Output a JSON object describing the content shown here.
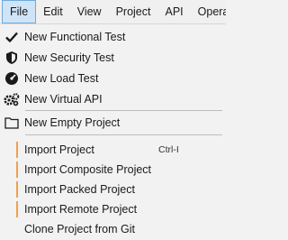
{
  "menubar": {
    "items": [
      "File",
      "Edit",
      "View",
      "Project",
      "API",
      "Operatio"
    ]
  },
  "menu": {
    "new_functional_test": "New Functional Test",
    "new_security_test": "New Security Test",
    "new_load_test": "New Load Test",
    "new_virtual_api": "New Virtual API",
    "new_empty_project": "New Empty Project",
    "import_project": "Import Project",
    "import_project_shortcut": "Ctrl-I",
    "import_composite_project": "Import Composite Project",
    "import_packed_project": "Import Packed Project",
    "import_remote_project": "Import Remote Project",
    "clone_project_from_git": "Clone Project from Git"
  },
  "colors": {
    "accent_bar": "#f0a04b",
    "active_menu_bg": "#cfe4f6",
    "active_menu_border": "#6fa9dc"
  }
}
